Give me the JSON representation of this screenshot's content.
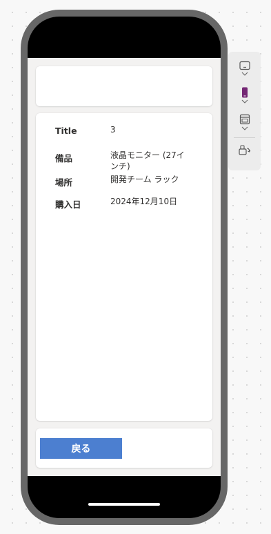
{
  "form": {
    "fields": [
      {
        "label": "Title",
        "value": "3"
      },
      {
        "label": "備品",
        "value": "液晶モニター (27インチ)"
      },
      {
        "label": "場所",
        "value": "開発チーム ラック"
      },
      {
        "label": "購入日",
        "value": "2024年12月10日"
      }
    ]
  },
  "footer": {
    "back_label": "戻る"
  },
  "toolbar": {
    "icons": [
      "tablet-landscape-icon",
      "phone-portrait-icon",
      "layout-icon",
      "device-rotate-icon"
    ]
  },
  "colors": {
    "button": "#4c7fd0",
    "phone_frame": "#676767",
    "selected_device": "#742774"
  }
}
